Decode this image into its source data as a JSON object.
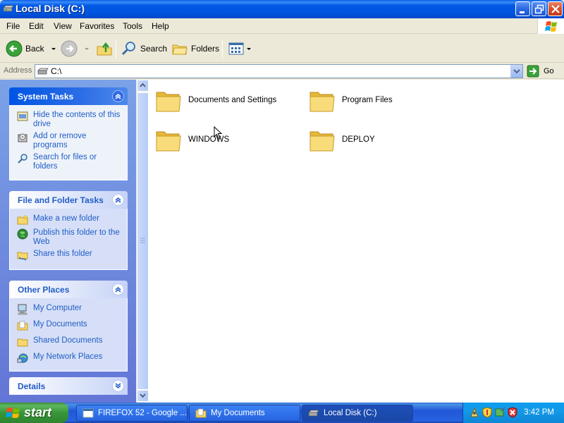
{
  "window": {
    "title": "Local Disk (C:)"
  },
  "menu": [
    "File",
    "Edit",
    "View",
    "Favorites",
    "Tools",
    "Help"
  ],
  "toolbar": {
    "back_label": "Back",
    "search_label": "Search",
    "folders_label": "Folders"
  },
  "address": {
    "label": "Address",
    "value": "C:\\",
    "go_label": "Go"
  },
  "panels": {
    "system_tasks": {
      "title": "System Tasks",
      "items": [
        "Hide the contents of this drive",
        "Add or remove programs",
        "Search for files or folders"
      ]
    },
    "file_folder_tasks": {
      "title": "File and Folder Tasks",
      "items": [
        "Make a new folder",
        "Publish this folder to the Web",
        "Share this folder"
      ]
    },
    "other_places": {
      "title": "Other Places",
      "items": [
        "My Computer",
        "My Documents",
        "Shared Documents",
        "My Network Places"
      ]
    },
    "details": {
      "title": "Details"
    }
  },
  "folders": [
    "Documents and Settings",
    "Program Files",
    "WINDOWS",
    "DEPLOY"
  ],
  "taskbar": {
    "start_label": "start",
    "buttons": [
      "FIREFOX 52 - Google ...",
      "My Documents",
      "Local Disk (C:)"
    ],
    "clock": "3:42 PM"
  },
  "colors": {
    "title_blue": "#0054E3",
    "task_link": "#215DC6",
    "pane_gradient_top": "#7BA2E7",
    "pane_gradient_bottom": "#6375D6",
    "start_green": "#379637",
    "folder_yellow": "#F5D76E"
  }
}
